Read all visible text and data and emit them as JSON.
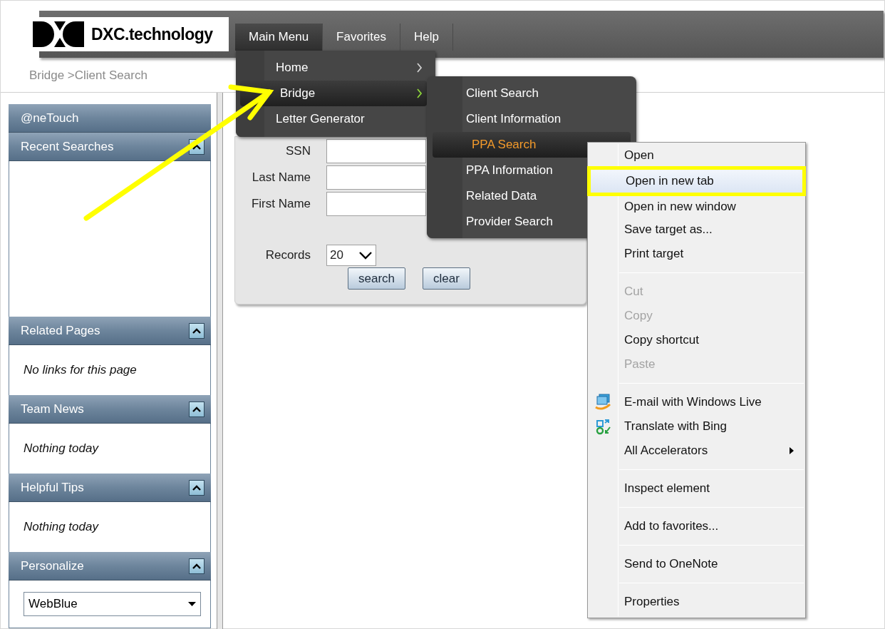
{
  "header": {
    "logo": "DXC.technology",
    "nav": [
      {
        "label": "Main Menu",
        "selected": true
      },
      {
        "label": "Favorites",
        "selected": false
      },
      {
        "label": "Help",
        "selected": false
      }
    ]
  },
  "breadcrumb": "Bridge >Client Search",
  "sidebar": {
    "title": "@neTouch",
    "panels": [
      {
        "title": "Recent Searches",
        "kind": "empty"
      },
      {
        "title": "Related Pages",
        "kind": "note",
        "text": "No links for this page"
      },
      {
        "title": "Team News",
        "kind": "note",
        "text": "Nothing today"
      },
      {
        "title": "Helpful Tips",
        "kind": "note",
        "text": "Nothing today"
      },
      {
        "title": "Personalize",
        "kind": "select",
        "value": "WebBlue"
      }
    ]
  },
  "form": {
    "fields": [
      {
        "label": "SSN"
      },
      {
        "label": "Last Name"
      },
      {
        "label": "First Name"
      }
    ],
    "records": {
      "label": "Records",
      "value": "20"
    },
    "buttons": [
      "search",
      "clear"
    ]
  },
  "main_menu": {
    "items": [
      {
        "label": "Home",
        "selected": false,
        "submenu": true
      },
      {
        "label": "Bridge",
        "selected": true,
        "submenu": true
      },
      {
        "label": "Letter Generator",
        "selected": false,
        "submenu": false
      }
    ]
  },
  "submenu": {
    "items": [
      {
        "label": "Client Search",
        "selected": false
      },
      {
        "label": "Client Information",
        "selected": false
      },
      {
        "label": "PPA Search",
        "selected": true
      },
      {
        "label": "PPA Information",
        "selected": false
      },
      {
        "label": "Related Data",
        "selected": false
      },
      {
        "label": "Provider Search",
        "selected": false
      }
    ]
  },
  "context_menu": {
    "groups": [
      [
        {
          "label": "Open",
          "kind": "text",
          "disabled": false,
          "selected": false
        },
        {
          "label": "Open in new tab",
          "kind": "text",
          "disabled": false,
          "selected": true
        },
        {
          "label": "Open in new window",
          "kind": "text",
          "disabled": false,
          "selected": false
        },
        {
          "label": "Save target as...",
          "kind": "text",
          "disabled": false,
          "selected": false
        },
        {
          "label": "Print target",
          "kind": "text",
          "disabled": false,
          "selected": false
        }
      ],
      [
        {
          "label": "Cut",
          "kind": "text",
          "disabled": true,
          "selected": false
        },
        {
          "label": "Copy",
          "kind": "text",
          "disabled": true,
          "selected": false
        },
        {
          "label": "Copy shortcut",
          "kind": "text",
          "disabled": false,
          "selected": false
        },
        {
          "label": "Paste",
          "kind": "text",
          "disabled": true,
          "selected": false
        }
      ],
      [
        {
          "label": "E-mail with Windows Live",
          "kind": "email",
          "disabled": false,
          "selected": false
        },
        {
          "label": "Translate with Bing",
          "kind": "translate",
          "disabled": false,
          "selected": false
        },
        {
          "label": "All Accelerators",
          "kind": "submenu",
          "disabled": false,
          "selected": false
        }
      ],
      [
        {
          "label": "Inspect element",
          "kind": "text",
          "disabled": false,
          "selected": false
        }
      ],
      [
        {
          "label": "Add to favorites...",
          "kind": "text",
          "disabled": false,
          "selected": false
        }
      ],
      [
        {
          "label": "Send to OneNote",
          "kind": "text",
          "disabled": false,
          "selected": false
        }
      ],
      [
        {
          "label": "Properties",
          "kind": "text",
          "disabled": false,
          "selected": false
        }
      ]
    ]
  }
}
